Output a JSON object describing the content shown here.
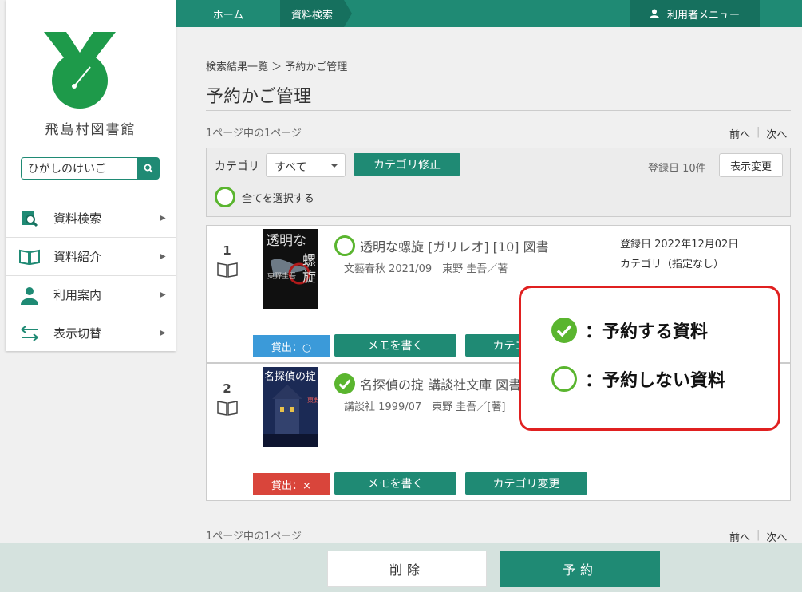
{
  "topbar": {
    "home": "ホーム",
    "search": "資料検索",
    "user_menu": "利用者メニュー"
  },
  "sidebar": {
    "library_name": "飛島村図書館",
    "search_value": "ひがしのけいご",
    "items": [
      {
        "label": "資料検索"
      },
      {
        "label": "資料紹介"
      },
      {
        "label": "利用案内"
      },
      {
        "label": "表示切替"
      }
    ]
  },
  "main": {
    "breadcrumb": "検索結果一覧 ＞ 予約かご管理",
    "title": "予約かご管理",
    "page_info": "1ページ中の1ページ",
    "prev": "前へ",
    "next": "次へ",
    "category_label": "カテゴリ",
    "category_value": "すべて",
    "category_edit": "カテゴリ修正",
    "sort_info": "登録日 10件",
    "display_change": "表示変更",
    "select_all": "全てを選択する"
  },
  "items": [
    {
      "number": "1",
      "title": "透明な螺旋 [ガリレオ] [10] 図書",
      "meta": "文藝春秋 2021/09　東野 圭吾／著",
      "registered": "登録日 2022年12月02日",
      "category": "カテゴリ（指定なし）",
      "status": "貸出：○",
      "memo": "メモを書く",
      "category_button": "カテゴリ変更",
      "selected": false,
      "status_color": "#3b9ad9"
    },
    {
      "number": "2",
      "title": "名探偵の掟 講談社文庫 図書",
      "meta": "講談社 1999/07　東野 圭吾／[著]",
      "status": "貸出：×",
      "memo": "メモを書く",
      "category_button": "カテゴリ変更",
      "selected": true,
      "status_color": "#d9453b"
    }
  ],
  "legend": {
    "reserve": "：予約する資料",
    "no_reserve": "：予約しない資料"
  },
  "footer": {
    "delete": "削除",
    "reserve": "予約"
  },
  "colors": {
    "accent": "#1f8a74",
    "check": "#5ab52f",
    "callout": "#e02020"
  }
}
